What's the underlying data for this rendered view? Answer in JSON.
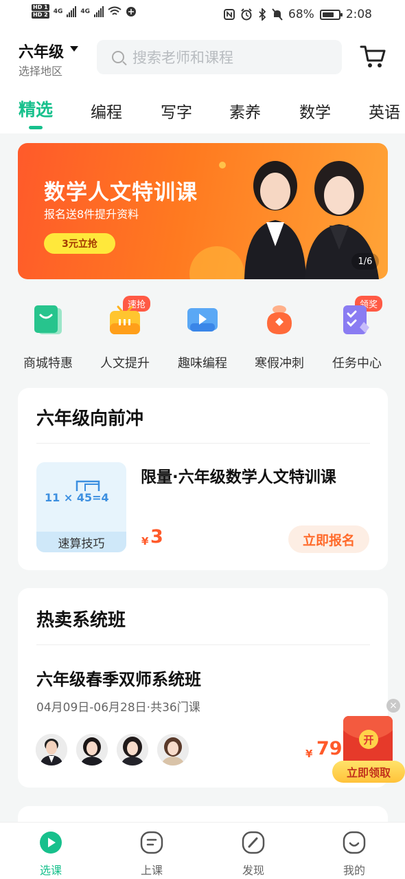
{
  "status_bar": {
    "hd1": "HD 1",
    "hd2": "HD 2",
    "net1": "4G",
    "net2": "4G",
    "battery": "68%",
    "time": "2:08"
  },
  "header": {
    "grade": "六年级",
    "region": "选择地区",
    "search_placeholder": "搜索老师和课程"
  },
  "tabs": [
    "精选",
    "编程",
    "写字",
    "素养",
    "数学",
    "英语"
  ],
  "banner": {
    "title": "数学人文特训课",
    "subtitle": "报名送8件提升资料",
    "button": "3元立抢",
    "index": "1/6"
  },
  "quick_links": [
    {
      "label": "商城特惠",
      "icon": "shopping-bag-icon",
      "badge": ""
    },
    {
      "label": "人文提升",
      "icon": "tv-box-icon",
      "badge": "速抢"
    },
    {
      "label": "趣味编程",
      "icon": "play-screen-icon",
      "badge": ""
    },
    {
      "label": "寒假冲刺",
      "icon": "lucky-bag-icon",
      "badge": ""
    },
    {
      "label": "任务中心",
      "icon": "checklist-icon",
      "badge": "领奖"
    }
  ],
  "section1": {
    "title": "六年级向前冲",
    "thumb_formula": "11 × 45=4",
    "thumb_caption": "速算技巧",
    "course": "限量·六年级数学人文特训课",
    "price_symbol": "¥",
    "price": "3",
    "button": "立即报名"
  },
  "section2": {
    "title": "热卖系统班",
    "class_name": "六年级春季双师系统班",
    "class_date": "04月09日-06月28日·共36门课",
    "price_symbol": "¥",
    "price": "79"
  },
  "red_packet": {
    "coin": "开",
    "button": "立即领取"
  },
  "bottom_nav": [
    {
      "label": "选课",
      "icon": "play-circle-icon",
      "active": true
    },
    {
      "label": "上课",
      "icon": "chat-square-icon",
      "active": false
    },
    {
      "label": "发现",
      "icon": "compass-pen-icon",
      "active": false
    },
    {
      "label": "我的",
      "icon": "smile-face-icon",
      "active": false
    }
  ],
  "colors": {
    "accent": "#17c08c",
    "price": "#ff5a2a",
    "banner": "#ff6a25"
  }
}
